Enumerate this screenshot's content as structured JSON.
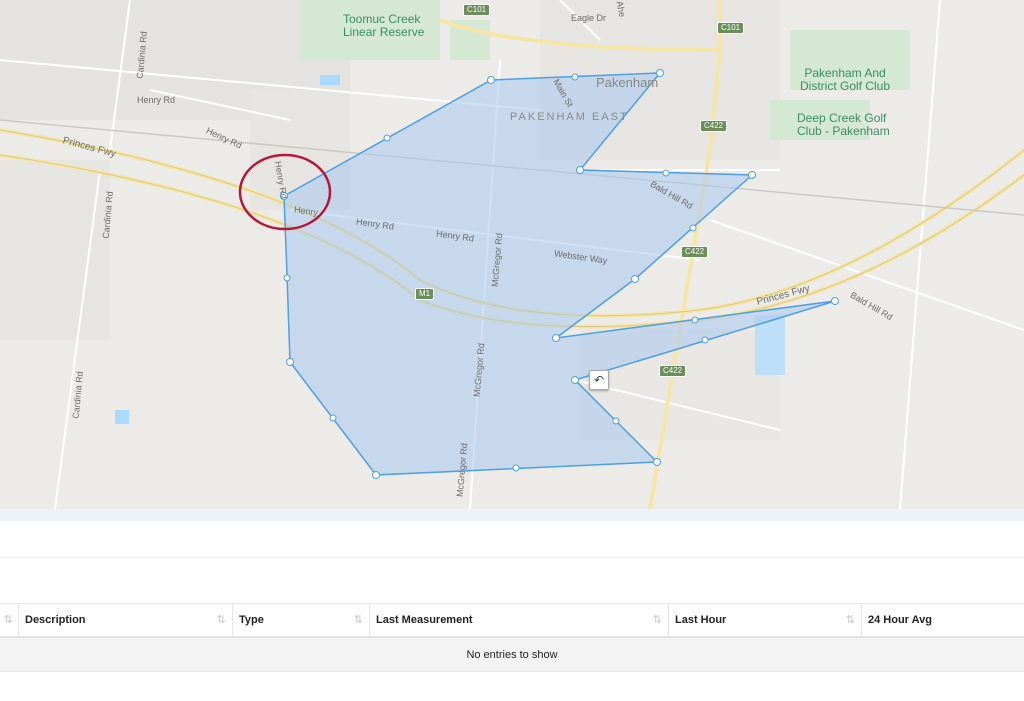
{
  "map": {
    "labels": {
      "toomuc_creek": "Toomuc Creek\nLinear Reserve",
      "pakenham_golf": "Pakenham And\nDistrict Golf Club",
      "deep_creek_golf": "Deep Creek Golf\nClub - Pakenham",
      "pakenham": "Pakenham",
      "pakenham_east": "PAKENHAM EAST",
      "cardinia_rd_top": "Cardinia Rd",
      "cardinia_rd_mid": "Cardinia Rd",
      "cardinia_rd_bottom": "Cardinia Rd",
      "henry_rd_1": "Henry Rd",
      "henry_rd_2": "Henry Rd",
      "henry_rd_3": "Henry Rd",
      "henry_rd_4": "Henry Rd",
      "henry_rd_5": "Henry Rd",
      "henry_rd_6": "Henry",
      "princes_fwy_left": "Princes Fwy",
      "princes_fwy_right": "Princes Fwy",
      "bald_hill_rd_1": "Bald Hill Rd",
      "bald_hill_rd_2": "Bald Hill Rd",
      "webster_way": "Webster Way",
      "mcgregor_rd_1": "McGregor Rd",
      "mcgregor_rd_2": "McGregor Rd",
      "mcgregor_rd_3": "McGregor Rd",
      "eagle_dr": "Eagle Dr",
      "main_st": "Main St",
      "ahe": "Ahe"
    },
    "shields": {
      "c101_a": "C101",
      "c101_b": "C101",
      "c422_a": "C422",
      "c422_b": "C422",
      "c422_c": "C422",
      "m1": "M1"
    },
    "undo_icon": "undo-icon",
    "colors": {
      "polygon_fill": "#a9c9ef",
      "polygon_stroke": "#4f9ee0",
      "highlight_circle": "#b5163a"
    }
  },
  "table": {
    "columns": [
      "",
      "Description",
      "Type",
      "Last Measurement",
      "Last Hour",
      "24 Hour Avg"
    ],
    "empty_message": "No entries to show",
    "sort_icon": "sort-icon"
  }
}
